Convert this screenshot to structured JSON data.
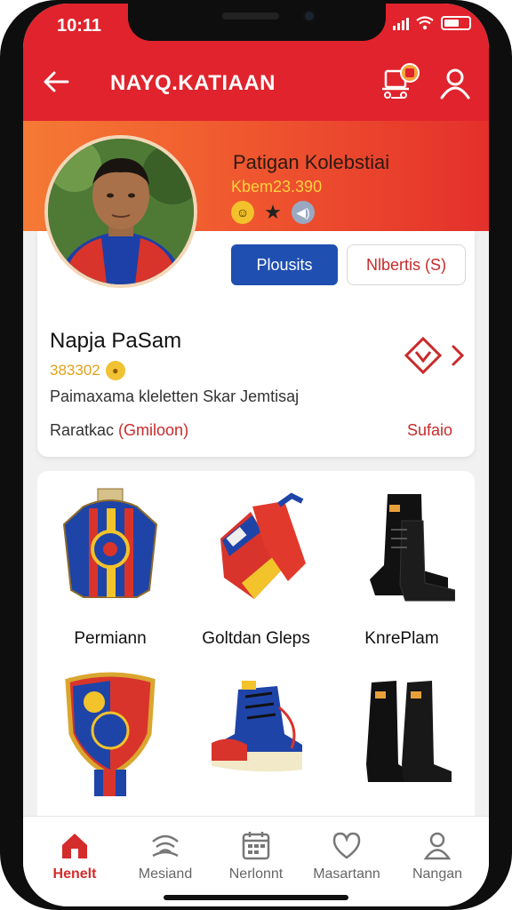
{
  "status_bar": {
    "time": "10:11"
  },
  "app_bar": {
    "title": "NAYQ.KATIAAN",
    "back_icon": "arrow-left-icon",
    "cart_icon": "cart-icon",
    "profile_icon": "user-icon"
  },
  "profile": {
    "name": "Patigan Kolebstiai",
    "subtitle": "Kbem23.390",
    "primary_button": "Plousits",
    "secondary_button": "Nlbertis (S)",
    "accent_colors": {
      "header": "#e0232c",
      "band_start": "#f57a34",
      "primary": "#1f4fb0"
    }
  },
  "detail": {
    "title": "Napja PaSam",
    "rating": "383302",
    "description": "Paimaxama kleletten Skar Jemtisaj",
    "meta_prefix": "Raratkac",
    "meta_highlight": "(Gmiloon)",
    "link": "Sufaio"
  },
  "items": [
    {
      "label": "Permiann",
      "icon": "jersey-icon"
    },
    {
      "label": "Goltdan Gleps",
      "icon": "gloves-icon"
    },
    {
      "label": "KnrePlam",
      "icon": "boots-icon"
    },
    {
      "label": "",
      "icon": "crest-scarf-icon"
    },
    {
      "label": "",
      "icon": "sneaker-icon"
    },
    {
      "label": "",
      "icon": "tall-boots-icon"
    }
  ],
  "bottom_nav": [
    {
      "label": "Henelt",
      "icon": "home-icon",
      "active": true
    },
    {
      "label": "Mesiand",
      "icon": "wifi-icon",
      "active": false
    },
    {
      "label": "Nerlonnt",
      "icon": "calendar-icon",
      "active": false
    },
    {
      "label": "Masartann",
      "icon": "heart-icon",
      "active": false
    },
    {
      "label": "Nangan",
      "icon": "person-icon",
      "active": false
    }
  ]
}
